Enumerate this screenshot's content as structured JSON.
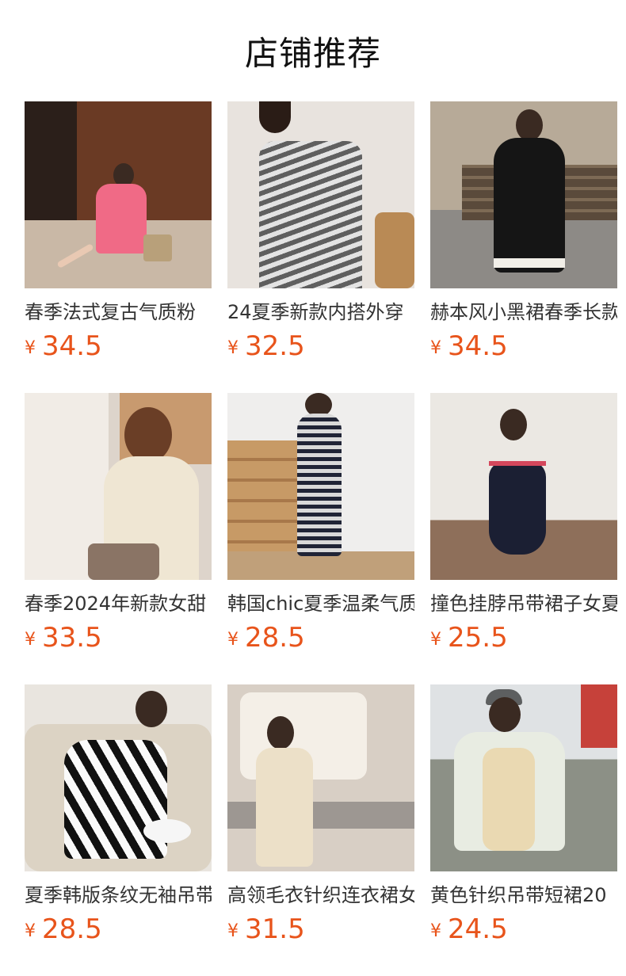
{
  "section_title": "店铺推荐",
  "currency_symbol": "¥",
  "price_color": "#e8541b",
  "products": [
    {
      "name": "春季法式复古气质粉",
      "price": "34.5"
    },
    {
      "name": "24夏季新款内搭外穿",
      "price": "32.5"
    },
    {
      "name": "赫本风小黑裙春季长款",
      "price": "34.5"
    },
    {
      "name": "春季2024年新款女甜",
      "price": "33.5"
    },
    {
      "name": "韩国chic夏季温柔气质",
      "price": "28.5"
    },
    {
      "name": "撞色挂脖吊带裙子女夏",
      "price": "25.5"
    },
    {
      "name": "夏季韩版条纹无袖吊带",
      "price": "28.5"
    },
    {
      "name": "高领毛衣针织连衣裙女",
      "price": "31.5"
    },
    {
      "name": "黄色针织吊带短裙20",
      "price": "24.5"
    }
  ]
}
